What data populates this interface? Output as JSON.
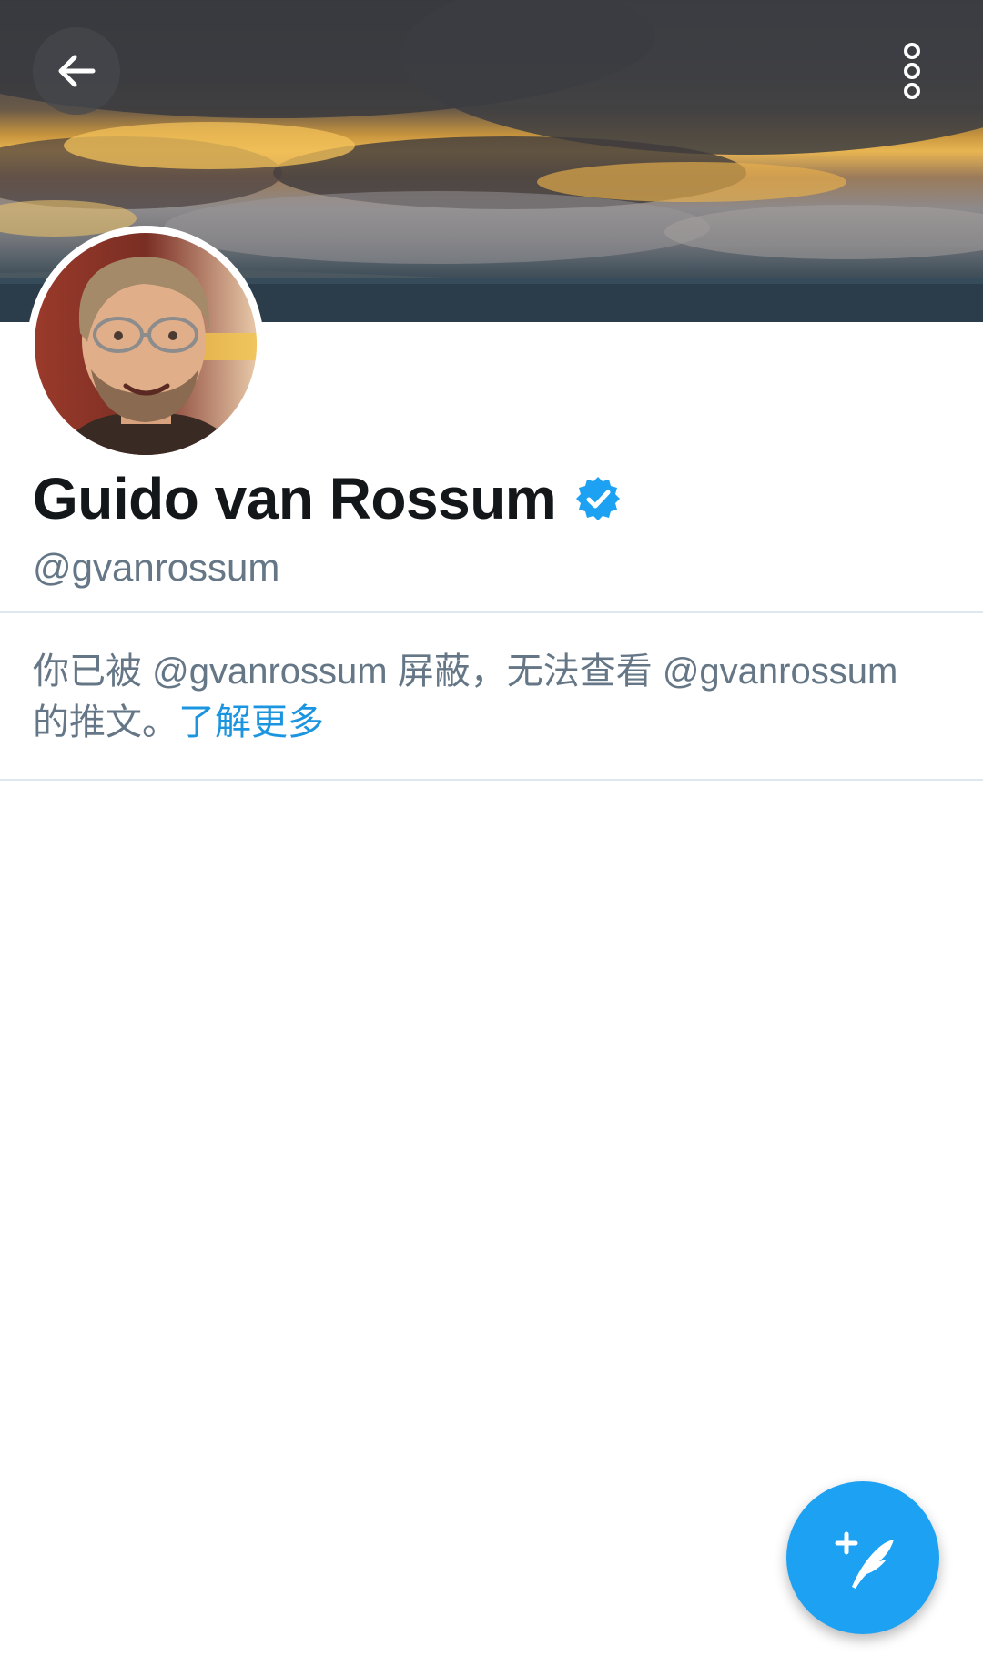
{
  "profile": {
    "name": "Guido van Rossum",
    "handle": "@gvanrossum",
    "verified": true
  },
  "blocked_notice": {
    "text": "你已被 @gvanrossum 屏蔽，无法查看 @gvanrossum 的推文。",
    "link_label": "了解更多"
  },
  "icons": {
    "back": "arrow-left-icon",
    "more": "vertical-dots-icon",
    "verified": "verified-badge-icon",
    "compose": "compose-tweet-icon"
  },
  "colors": {
    "accent": "#1da1f2",
    "link": "#1b95e0",
    "secondary_text": "#657786",
    "primary_text": "#14171a",
    "divider": "#e1e8ed"
  }
}
